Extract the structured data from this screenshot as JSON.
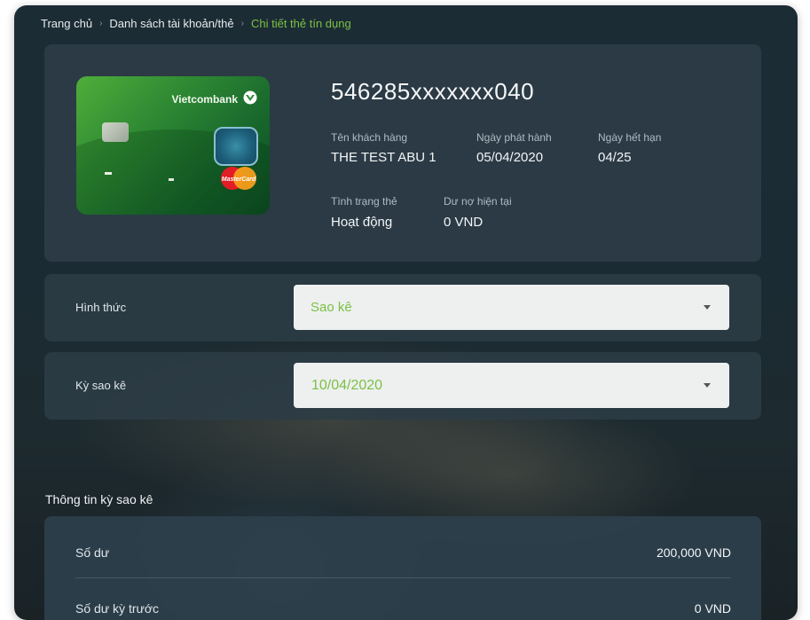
{
  "breadcrumb": {
    "home": "Trang chủ",
    "accounts": "Danh sách tài khoản/thẻ",
    "current": "Chi tiết thẻ tín dụng"
  },
  "card": {
    "brand": "Vietcombank",
    "network_label": "MasterCard",
    "number": "546285xxxxxxx040",
    "fields": {
      "customer_label": "Tên khách hàng",
      "customer_value": "THE TEST ABU 1",
      "issue_label": "Ngày phát hành",
      "issue_value": "05/04/2020",
      "expiry_label": "Ngày hết hạn",
      "expiry_value": "04/25",
      "status_label": "Tình trạng thẻ",
      "status_value": "Hoạt động",
      "debt_label": "Dư nợ hiện tại",
      "debt_value": "0 VND"
    }
  },
  "form": {
    "method_label": "Hình thức",
    "method_value": "Sao kê",
    "period_label": "Kỳ sao kê",
    "period_value": "10/04/2020"
  },
  "statement": {
    "title": "Thông tin kỳ sao kê",
    "rows": [
      {
        "label": "Số dư",
        "value": "200,000 VND"
      },
      {
        "label": "Số dư kỳ trước",
        "value": "0 VND"
      }
    ]
  },
  "colors": {
    "accent": "#7bc043",
    "panel": "#2c3c46",
    "background": "#1c2c35"
  },
  "icons": {
    "separator": "chevron-right-icon",
    "dropdown": "caret-down-icon"
  }
}
